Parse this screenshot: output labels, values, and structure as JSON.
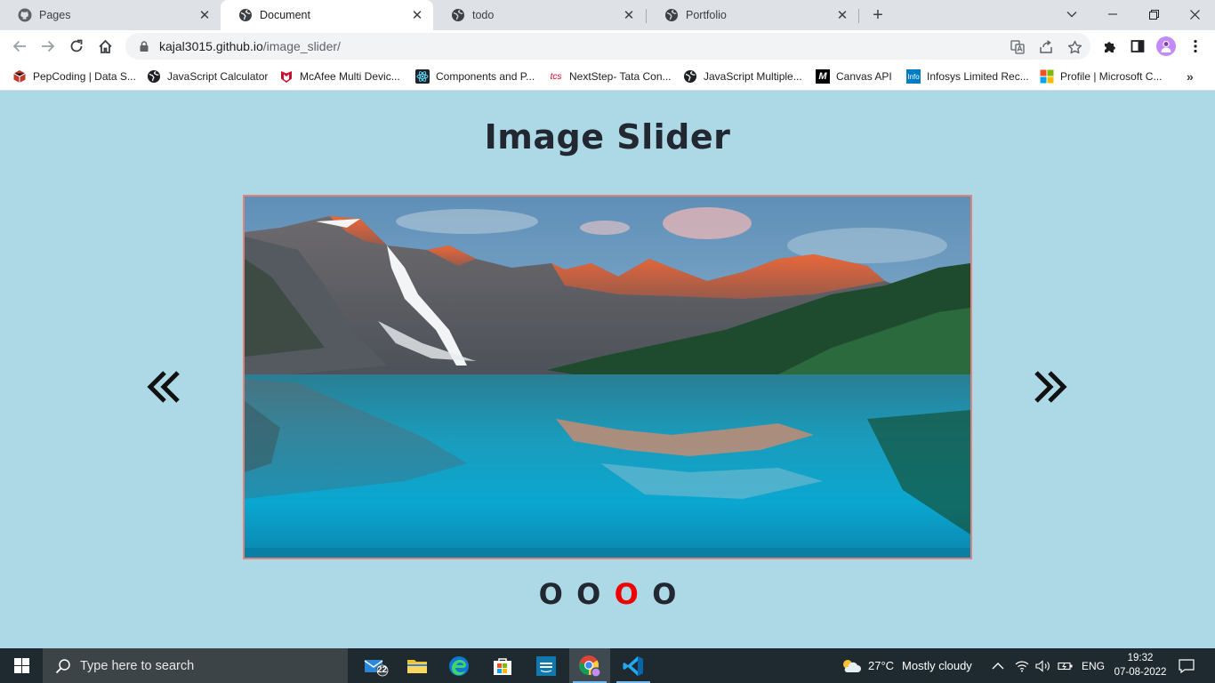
{
  "browser": {
    "tabs": [
      {
        "title": "Pages",
        "icon": "github-icon",
        "active": false
      },
      {
        "title": "Document",
        "icon": "globe-icon",
        "active": true
      },
      {
        "title": "todo",
        "icon": "globe-icon",
        "active": false
      },
      {
        "title": "Portfolio",
        "icon": "globe-icon",
        "active": false
      }
    ],
    "url_host": "kajal3015.github.io",
    "url_path": "/image_slider/",
    "bookmarks": [
      {
        "label": "PepCoding | Data S...",
        "icon": "pepcoding-icon"
      },
      {
        "label": "JavaScript Calculator",
        "icon": "globe-icon"
      },
      {
        "label": "McAfee Multi Devic...",
        "icon": "mcafee-icon"
      },
      {
        "label": "Components and P...",
        "icon": "react-icon"
      },
      {
        "label": "NextStep- Tata Con...",
        "icon": "tcs-icon"
      },
      {
        "label": "JavaScript Multiple...",
        "icon": "globe-icon"
      },
      {
        "label": "Canvas API",
        "icon": "mdn-icon"
      },
      {
        "label": "Infosys Limited Rec...",
        "icon": "infosys-icon"
      },
      {
        "label": "Profile | Microsoft C...",
        "icon": "microsoft-icon"
      }
    ],
    "tcs_text": "tcs",
    "mdn_text": "M",
    "infosys_text": "Info"
  },
  "page": {
    "title": "Image Slider",
    "prev_symbol": "«",
    "next_symbol": "»",
    "dots": [
      "O",
      "O",
      "O",
      "O"
    ],
    "active_dot_index": 2,
    "colors": {
      "background": "#add8e6",
      "frame_border": "#e0837a",
      "active_dot": "#ef0000",
      "text": "#222831"
    }
  },
  "taskbar": {
    "search_placeholder": "Type here to search",
    "mail_badge": "22",
    "weather_temp": "27°C",
    "weather_text": "Mostly cloudy",
    "language": "ENG",
    "time": "19:32",
    "date": "07-08-2022"
  }
}
